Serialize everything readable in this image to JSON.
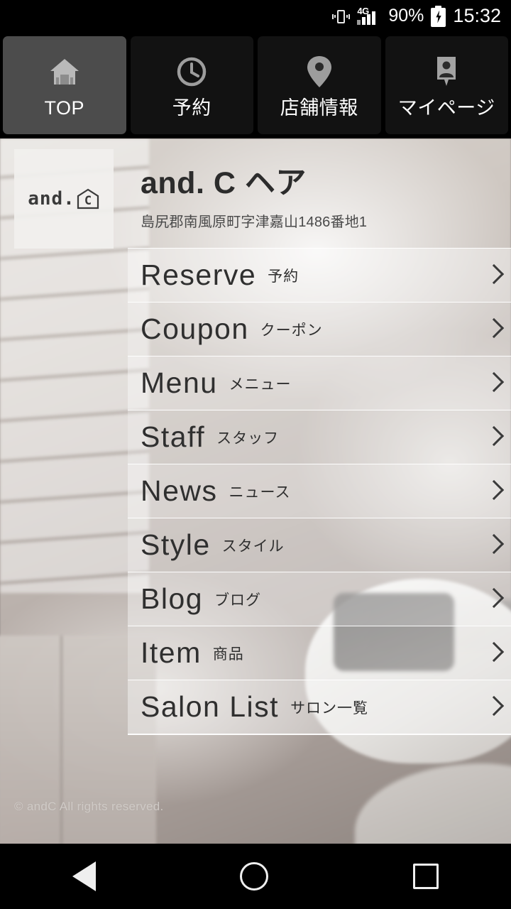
{
  "status_bar": {
    "vibrate_icon": "vibrate-icon",
    "network": "4G",
    "signal_icon": "signal-bars-icon",
    "battery_percent": "90%",
    "battery_icon": "battery-charging-icon",
    "time": "15:32"
  },
  "tabs": [
    {
      "label": "TOP",
      "icon": "home-icon",
      "active": true
    },
    {
      "label": "予約",
      "icon": "clock-icon",
      "active": false
    },
    {
      "label": "店舗情報",
      "icon": "map-pin-icon",
      "active": false
    },
    {
      "label": "マイページ",
      "icon": "person-badge-icon",
      "active": false
    }
  ],
  "logo": {
    "text": "and.",
    "mark_letter": "C",
    "mark_icon": "house-outline-icon"
  },
  "shop": {
    "name": "and. C ヘア",
    "address": "島尻郡南風原町字津嘉山1486番地1"
  },
  "menu_items": [
    {
      "en": "Reserve",
      "ja": "予約"
    },
    {
      "en": "Coupon",
      "ja": "クーポン"
    },
    {
      "en": "Menu",
      "ja": "メニュー"
    },
    {
      "en": "Staff",
      "ja": "スタッフ"
    },
    {
      "en": "News",
      "ja": "ニュース"
    },
    {
      "en": "Style",
      "ja": "スタイル"
    },
    {
      "en": "Blog",
      "ja": "ブログ"
    },
    {
      "en": "Item",
      "ja": "商品"
    },
    {
      "en": "Salon List",
      "ja": "サロン一覧"
    }
  ],
  "chevron_icon": "chevron-right-icon",
  "footer": {
    "copyright": "© andC All rights reserved."
  },
  "system_nav": {
    "back": "back-triangle-icon",
    "home": "home-circle-icon",
    "recents": "recents-square-icon"
  },
  "colors": {
    "tab_active_bg": "#4c4c4c",
    "tab_bg": "#121212",
    "system_bg": "#000000",
    "text_dark": "#2f2f2f"
  }
}
